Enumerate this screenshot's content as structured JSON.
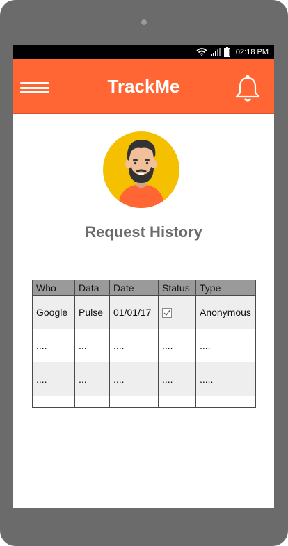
{
  "status_bar": {
    "time": "02:18 PM",
    "icons": [
      "wifi-icon",
      "signal-icon",
      "battery-icon"
    ]
  },
  "header": {
    "title": "TrackMe",
    "menu_icon": "hamburger-menu-icon",
    "notification_icon": "bell-icon"
  },
  "profile": {
    "avatar": "avatar-bearded-man"
  },
  "page": {
    "title": "Request History"
  },
  "table": {
    "columns": [
      "Who",
      "Data",
      "Date",
      "Status",
      "Type"
    ],
    "rows": [
      {
        "who": "Google",
        "data": "Pulse",
        "date": "01/01/17",
        "status": "checked",
        "type": "Anonymous"
      },
      {
        "who": "....",
        "data": "...",
        "date": "....",
        "status": "....",
        "type": "...."
      },
      {
        "who": "....",
        "data": "...",
        "date": "....",
        "status": "....",
        "type": "....."
      },
      {
        "who": "",
        "data": "",
        "date": "",
        "status": "",
        "type": ""
      }
    ]
  },
  "colors": {
    "header_bg": "#ff6633",
    "avatar_bg": "#f5c000",
    "shirt": "#ff6633",
    "title_text": "#6b6b6b",
    "table_header_bg": "#9a9a9a",
    "row_stripe": "#eeeeee"
  }
}
